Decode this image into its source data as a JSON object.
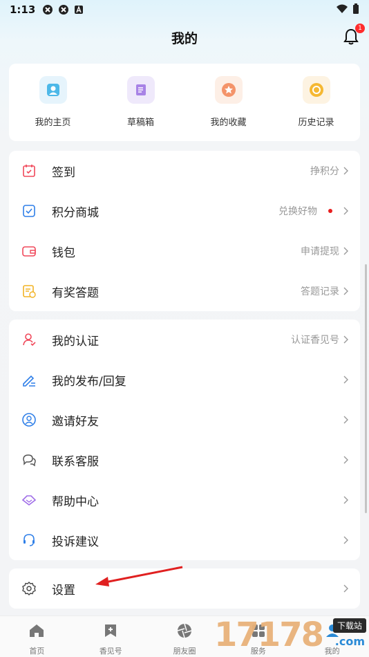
{
  "status": {
    "time": "1:13"
  },
  "header": {
    "title": "我的",
    "notif_count": "1"
  },
  "quick_links": [
    {
      "label": "我的主页",
      "icon": "user-icon",
      "bg": "#e6f4fc",
      "fg": "#4db8e8"
    },
    {
      "label": "草稿箱",
      "icon": "scroll-icon",
      "bg": "#efe9fb",
      "fg": "#a883e6"
    },
    {
      "label": "我的收藏",
      "icon": "star-icon",
      "bg": "#fdefe6",
      "fg": "#f4946a"
    },
    {
      "label": "历史记录",
      "icon": "clock-icon",
      "bg": "#fdf3e2",
      "fg": "#f5b833"
    }
  ],
  "group1": [
    {
      "label": "签到",
      "sub": "挣积分",
      "icon": "calendar-icon",
      "color": "#f0485a"
    },
    {
      "label": "积分商城",
      "sub": "兑换好物",
      "icon": "shop-icon",
      "color": "#2f7fe8",
      "dot": true
    },
    {
      "label": "钱包",
      "sub": "申请提现",
      "icon": "wallet-icon",
      "color": "#f0485a"
    },
    {
      "label": "有奖答题",
      "sub": "答题记录",
      "icon": "quiz-icon",
      "color": "#f2b324"
    }
  ],
  "group2": [
    {
      "label": "我的认证",
      "sub": "认证香见号",
      "icon": "verify-icon",
      "color": "#f0485a"
    },
    {
      "label": "我的发布/回复",
      "sub": "",
      "icon": "edit-icon",
      "color": "#2f7fe8"
    },
    {
      "label": "邀请好友",
      "sub": "",
      "icon": "invite-icon",
      "color": "#2f7fe8"
    },
    {
      "label": "联系客服",
      "sub": "",
      "icon": "chat-icon",
      "color": "#555555"
    },
    {
      "label": "帮助中心",
      "sub": "",
      "icon": "help-icon",
      "color": "#a06ee8"
    },
    {
      "label": "投诉建议",
      "sub": "",
      "icon": "headset-icon",
      "color": "#2f7fe8"
    }
  ],
  "group3": [
    {
      "label": "设置",
      "sub": "",
      "icon": "gear-icon",
      "color": "#444444"
    }
  ],
  "tabs": [
    {
      "label": "首页",
      "icon": "home-icon"
    },
    {
      "label": "香见号",
      "icon": "bookmark-icon"
    },
    {
      "label": "朋友圈",
      "icon": "aperture-icon"
    },
    {
      "label": "服务",
      "icon": "grid-icon"
    },
    {
      "label": "我的",
      "icon": "profile-icon"
    }
  ],
  "watermark": {
    "digits": "17178",
    "tag": "下载站",
    "suffix": ".com"
  }
}
